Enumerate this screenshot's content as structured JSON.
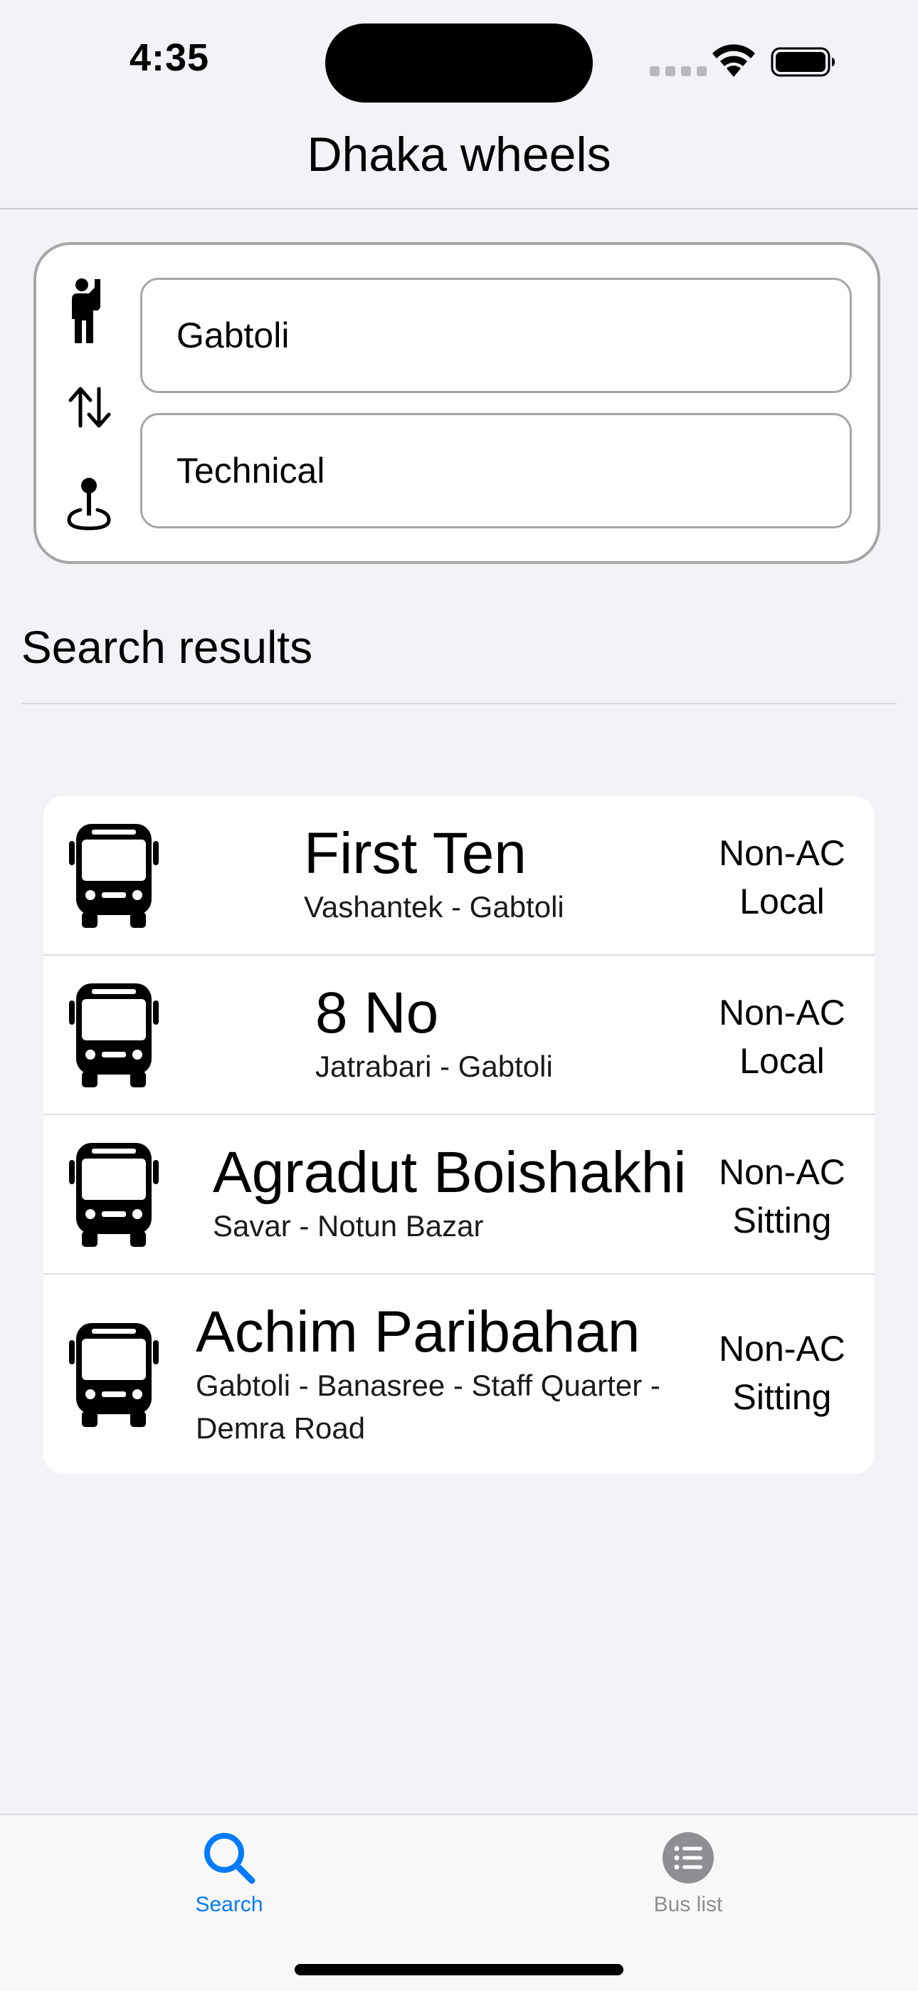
{
  "status_bar": {
    "time": "4:35",
    "signal_icon": "cellular-signal-icon",
    "wifi_icon": "wifi-icon",
    "battery_icon": "battery-full-icon"
  },
  "header": {
    "title": "Dhaka wheels"
  },
  "search": {
    "origin_icon": "person-raised-hand-icon",
    "swap_icon": "swap-arrows-icon",
    "destination_icon": "map-pin-icon",
    "origin_value": "Gabtoli",
    "destination_value": "Technical"
  },
  "results": {
    "heading": "Search results",
    "items": [
      {
        "icon": "bus-icon",
        "name": "First Ten",
        "route": "Vashantek - Gabtoli",
        "type_line1": "Non-AC",
        "type_line2": "Local"
      },
      {
        "icon": "bus-icon",
        "name": "8 No",
        "route": "Jatrabari - Gabtoli",
        "type_line1": "Non-AC",
        "type_line2": "Local"
      },
      {
        "icon": "bus-icon",
        "name": "Agradut Boishakhi",
        "route": "Savar - Notun Bazar",
        "type_line1": "Non-AC",
        "type_line2": "Sitting"
      },
      {
        "icon": "bus-icon",
        "name": "Achim Paribahan",
        "route": "Gabtoli - Banasree - Staff Quarter - Demra Road",
        "type_line1": "Non-AC",
        "type_line2": "Sitting"
      }
    ]
  },
  "tab_bar": {
    "tabs": [
      {
        "label": "Search",
        "icon": "magnifying-glass-icon",
        "selected": true
      },
      {
        "label": "Bus list",
        "icon": "list-icon",
        "selected": false
      }
    ]
  },
  "colors": {
    "accent": "#007aff",
    "inactive_tab": "#8e8e93",
    "background": "#f2f2f7"
  }
}
